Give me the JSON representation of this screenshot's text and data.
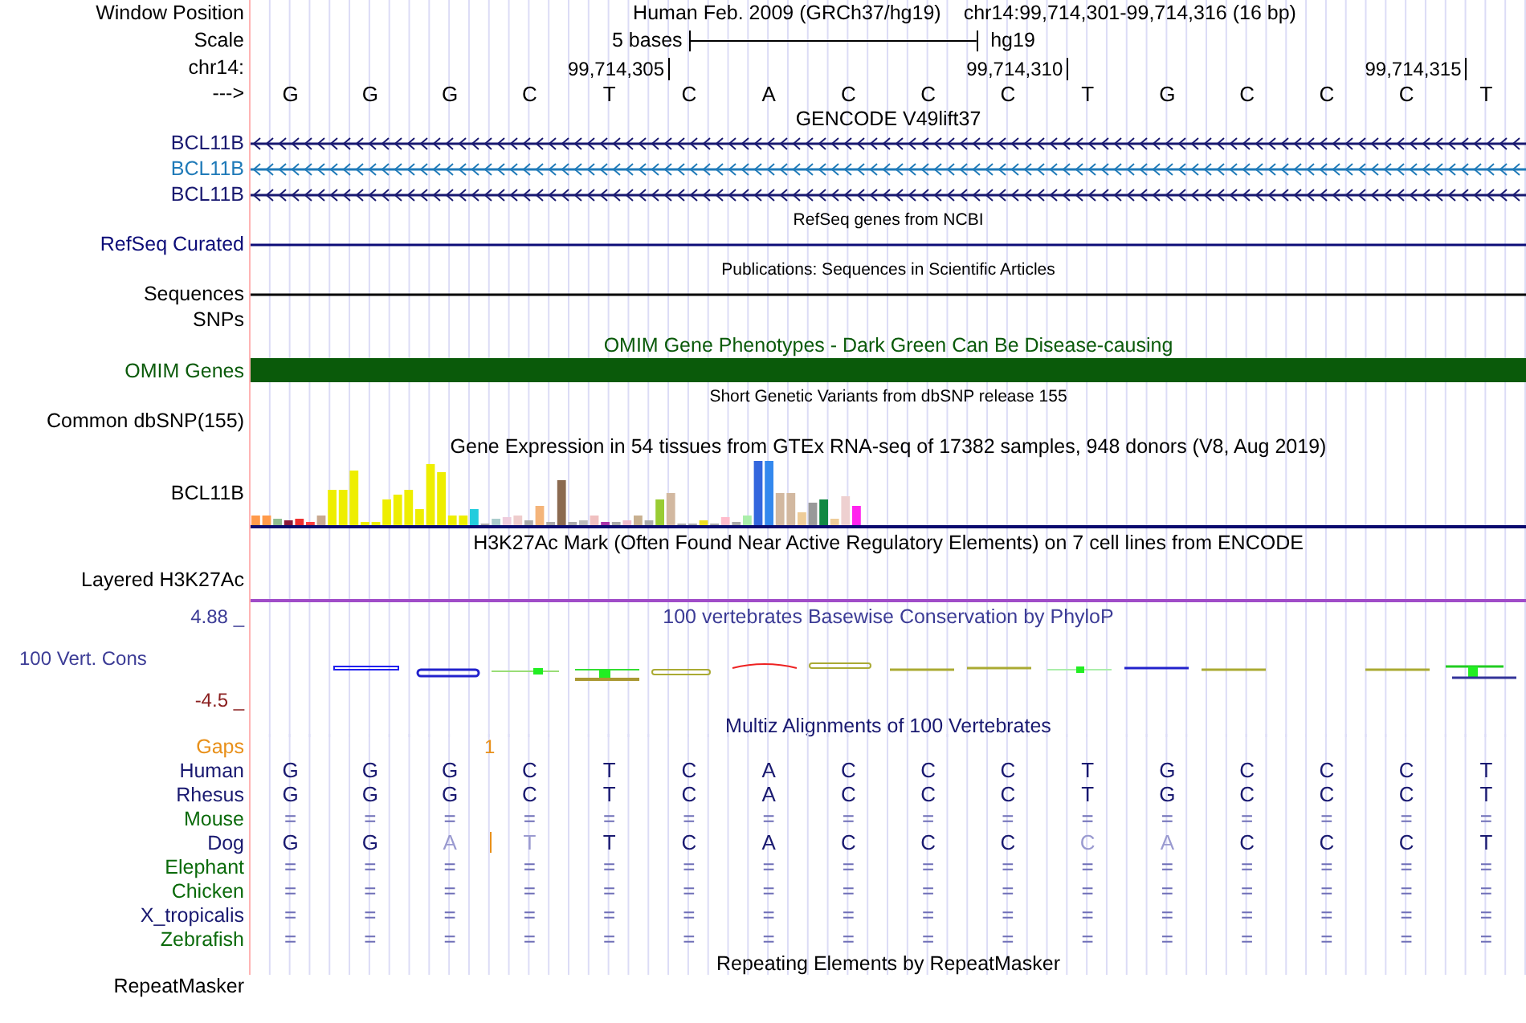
{
  "header": {
    "label": "Window Position",
    "assembly": "Human Feb. 2009 (GRCh37/hg19)",
    "position": "chr14:99,714,301-99,714,316 (16 bp)"
  },
  "scale": {
    "label": "Scale",
    "span": "5 bases",
    "database": "hg19"
  },
  "coordinates": {
    "label": "chr14:",
    "ticks": [
      "99,714,305",
      "99,714,310",
      "99,714,315"
    ]
  },
  "sequence": {
    "label": "--->",
    "bases": [
      "G",
      "G",
      "G",
      "C",
      "T",
      "C",
      "A",
      "C",
      "C",
      "C",
      "T",
      "G",
      "C",
      "C",
      "C",
      "T"
    ]
  },
  "tracks": [
    {
      "kind": "genes",
      "title": "GENCODE V49lift37",
      "items": [
        {
          "label": "BCL11B",
          "color": "#191970",
          "kind": "gene"
        },
        {
          "label": "BCL11B",
          "color": "#1f7ab8",
          "kind": "gene"
        },
        {
          "label": "BCL11B",
          "color": "#191970",
          "kind": "gene"
        }
      ]
    },
    {
      "kind": "genes",
      "title": "RefSeq genes from NCBI",
      "items": [
        {
          "label": "RefSeq Curated",
          "color": "#0c0c78",
          "kind": "span"
        }
      ]
    },
    {
      "kind": "genes",
      "title": "Publications: Sequences in Scientific Articles",
      "items": [
        {
          "label": "Sequences",
          "color": "#000000",
          "kind": "span"
        },
        {
          "label": "SNPs",
          "color": "#000000",
          "kind": "empty"
        }
      ]
    },
    {
      "kind": "block",
      "title": "OMIM Gene Phenotypes - Dark Green Can Be Disease-causing",
      "label": "OMIM Genes",
      "color": "#0a5a0a"
    },
    {
      "kind": "genes",
      "title": "Short Genetic Variants from dbSNP release 155",
      "items": [
        {
          "label": "Common dbSNP(155)",
          "color": "#000000",
          "kind": "empty"
        }
      ]
    },
    {
      "kind": "expression",
      "title": "Gene Expression in 54 tissues from GTEx RNA-seq of 17382 samples, 948 donors (V8, Aug 2019)",
      "label": "BCL11B"
    },
    {
      "kind": "layered",
      "title": "H3K27Ac Mark (Often Found Near Active Regulatory Elements) on 7 cell lines from ENCODE",
      "label": "Layered H3K27Ac"
    },
    {
      "kind": "conservation",
      "title": "100 vertebrates Basewise Conservation by PhyloP",
      "label": "100 Vert. Cons",
      "max": "4.88 _",
      "min": "-4.5 _"
    },
    {
      "kind": "alignment",
      "title": "Multiz Alignments of 100 Vertebrates",
      "gaps": {
        "label": "Gaps",
        "count": "1"
      },
      "species": [
        {
          "name": "Human",
          "color": "#191970",
          "bases": [
            "G",
            "G",
            "G",
            "C",
            "T",
            "C",
            "A",
            "C",
            "C",
            "C",
            "T",
            "G",
            "C",
            "C",
            "C",
            "T"
          ]
        },
        {
          "name": "Rhesus",
          "color": "#191970",
          "bases": [
            "G",
            "G",
            "G",
            "C",
            "T",
            "C",
            "A",
            "C",
            "C",
            "C",
            "T",
            "G",
            "C",
            "C",
            "C",
            "T"
          ]
        },
        {
          "name": "Mouse",
          "color": "#0a6a0a",
          "bases": [
            "=",
            "=",
            "=",
            "=",
            "=",
            "=",
            "=",
            "=",
            "=",
            "=",
            "=",
            "=",
            "=",
            "=",
            "=",
            "="
          ]
        },
        {
          "name": "Dog",
          "color": "#191970",
          "insertion": true,
          "bases": [
            "G",
            "G",
            "A",
            "T",
            "T",
            "C",
            "A",
            "C",
            "C",
            "C",
            "C",
            "A",
            "C",
            "C",
            "C",
            "T"
          ],
          "mismatch": [
            false,
            false,
            true,
            true,
            false,
            false,
            false,
            false,
            false,
            false,
            true,
            true,
            false,
            false,
            false,
            false
          ]
        },
        {
          "name": "Elephant",
          "color": "#0a6a0a",
          "bases": [
            "=",
            "=",
            "=",
            "=",
            "=",
            "=",
            "=",
            "=",
            "=",
            "=",
            "=",
            "=",
            "=",
            "=",
            "=",
            "="
          ]
        },
        {
          "name": "Chicken",
          "color": "#0a6a0a",
          "bases": [
            "=",
            "=",
            "=",
            "=",
            "=",
            "=",
            "=",
            "=",
            "=",
            "=",
            "=",
            "=",
            "=",
            "=",
            "=",
            "="
          ]
        },
        {
          "name": "X_tropicalis",
          "color": "#191970",
          "bases": [
            "=",
            "=",
            "=",
            "=",
            "=",
            "=",
            "=",
            "=",
            "=",
            "=",
            "=",
            "=",
            "=",
            "=",
            "=",
            "="
          ]
        },
        {
          "name": "Zebrafish",
          "color": "#0a6a0a",
          "bases": [
            "=",
            "=",
            "=",
            "=",
            "=",
            "=",
            "=",
            "=",
            "=",
            "=",
            "=",
            "=",
            "=",
            "=",
            "=",
            "="
          ]
        }
      ]
    },
    {
      "kind": "genes",
      "title": "Repeating Elements by RepeatMasker",
      "items": [
        {
          "label": "RepeatMasker",
          "color": "#000000",
          "kind": "empty"
        }
      ]
    }
  ]
}
